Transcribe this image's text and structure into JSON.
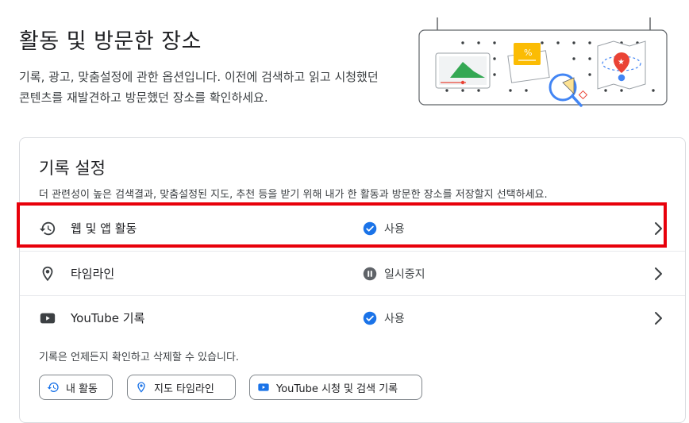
{
  "header": {
    "title": "활동 및 방문한 장소",
    "description": "기록, 광고, 맞춤설정에 관한 옵션입니다. 이전에 검색하고 읽고 시청했던 콘텐츠를 재발견하고 방문했던 장소를 확인하세요."
  },
  "history_card": {
    "title": "기록 설정",
    "description": "더 관련성이 높은 검색결과, 맞춤설정된 지도, 추천 등을 받기 위해 내가 한 활동과 방문한 장소를 저장할지 선택하세요.",
    "rows": [
      {
        "label": "웹 및 앱 활동",
        "icon": "history-icon",
        "status": "사용",
        "status_icon": "check-circle-icon"
      },
      {
        "label": "타임라인",
        "icon": "location-pin-icon",
        "status": "일시중지",
        "status_icon": "pause-circle-icon"
      },
      {
        "label": "YouTube 기록",
        "icon": "youtube-icon",
        "status": "사용",
        "status_icon": "check-circle-icon"
      }
    ],
    "footer_note": "기록은 언제든지 확인하고 삭제할 수 있습니다.",
    "chips": [
      {
        "label": "내 활동",
        "icon": "history-icon"
      },
      {
        "label": "지도 타임라인",
        "icon": "location-pin-icon"
      },
      {
        "label": "YouTube 시청 및 검색 기록",
        "icon": "youtube-icon"
      }
    ]
  },
  "colors": {
    "accent_blue": "#1a73e8",
    "highlight_red": "#e8000b",
    "paused_gray": "#5f6368"
  }
}
